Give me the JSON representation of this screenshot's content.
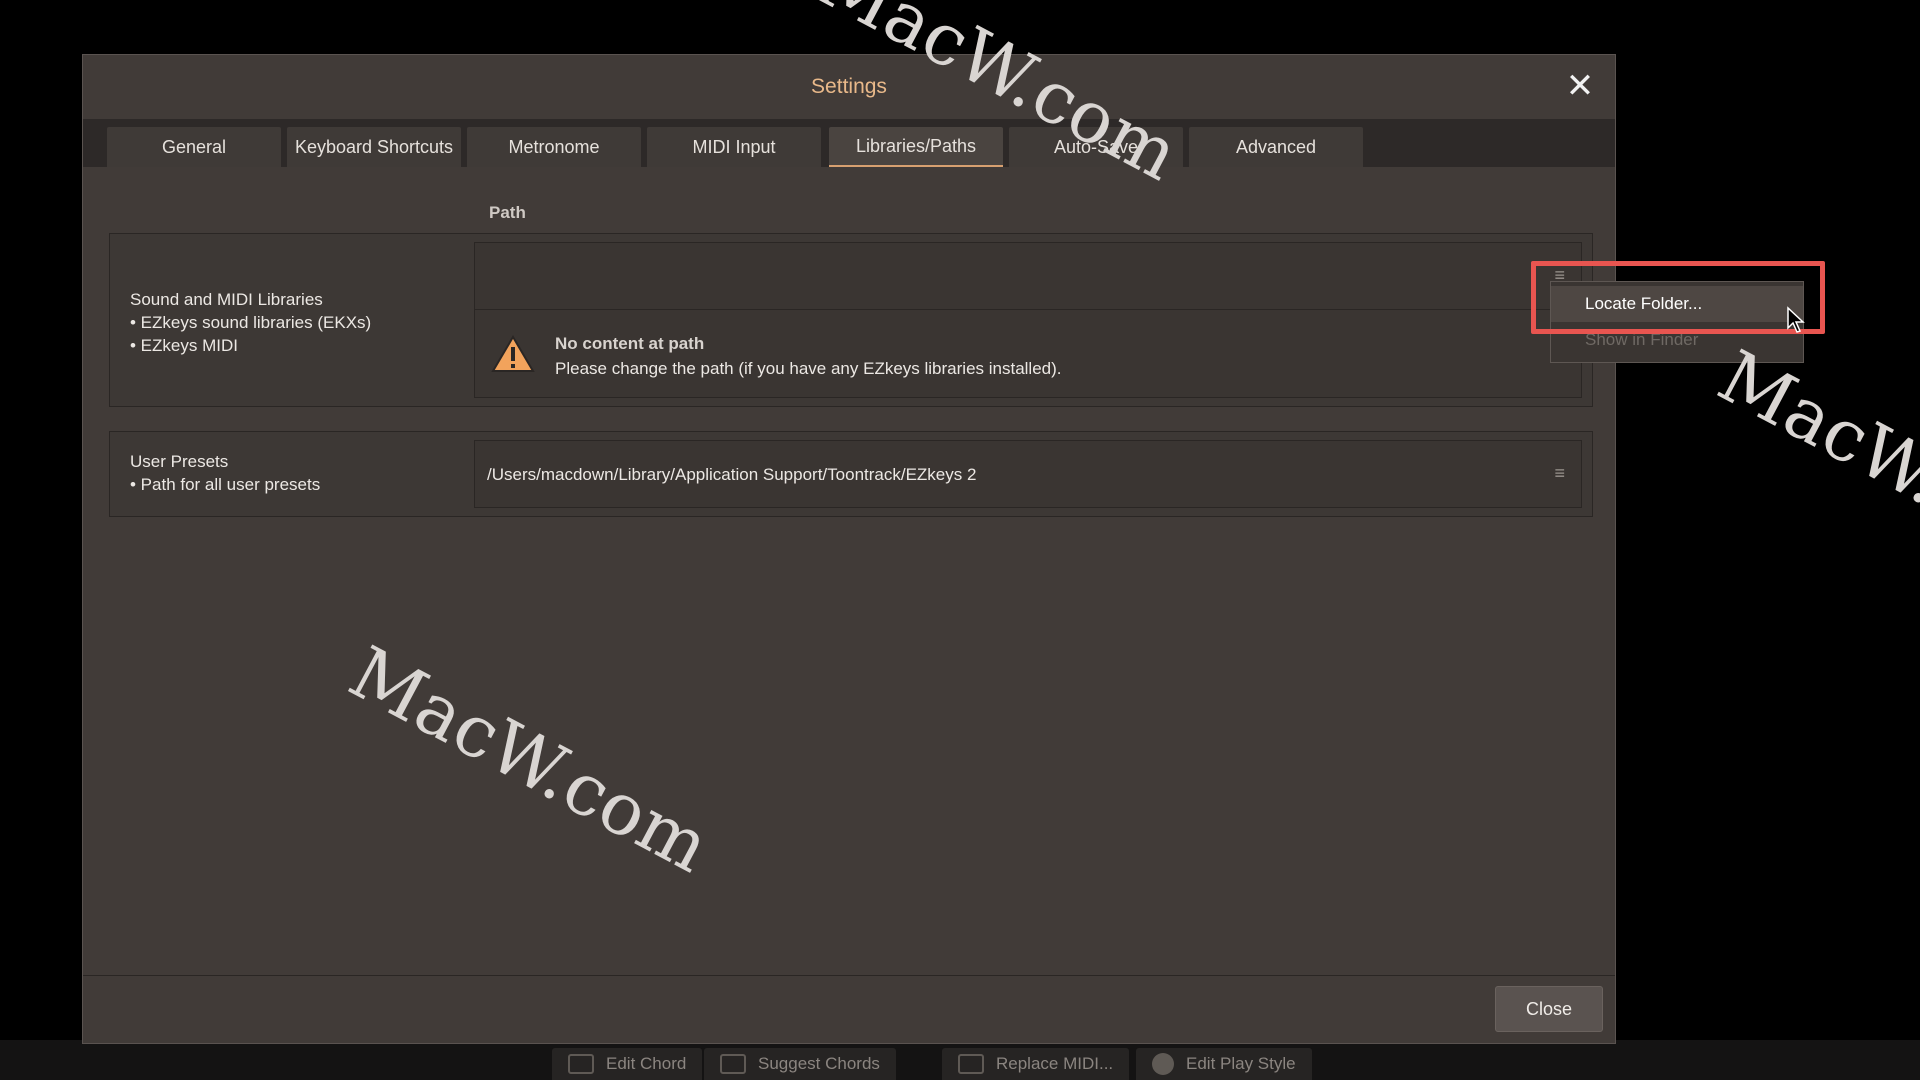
{
  "dialog": {
    "title": "Settings",
    "close_icon": "close-icon",
    "tabs": [
      {
        "label": "General"
      },
      {
        "label": "Keyboard Shortcuts"
      },
      {
        "label": "Metronome"
      },
      {
        "label": "MIDI Input"
      },
      {
        "label": "Libraries/Paths",
        "active": true
      },
      {
        "label": "Auto-Save"
      },
      {
        "label": "Advanced"
      }
    ],
    "column_header": "Path",
    "sections": [
      {
        "title": "Sound and MIDI Libraries",
        "bullets": [
          "• EZkeys sound libraries (EKXs)",
          "• EZkeys MIDI"
        ],
        "path": "",
        "warning": {
          "icon": "warning-icon",
          "title": "No content at path",
          "message": "Please change the path (if you have any EZkeys libraries installed)."
        }
      },
      {
        "title": "User Presets",
        "bullets": [
          "• Path for all user presets"
        ],
        "path": "/Users/macdown/Library/Application Support/Toontrack/EZkeys 2"
      }
    ],
    "menu_icon": "≡",
    "close_button": "Close"
  },
  "context_menu": {
    "items": [
      {
        "label": "Locate Folder...",
        "enabled": true
      },
      {
        "label": "Show in Finder",
        "enabled": false
      }
    ]
  },
  "host_toolbar": {
    "buttons": [
      "Edit Chord",
      "Suggest Chords",
      "Replace MIDI...",
      "Edit Play Style"
    ]
  },
  "watermark": "MacW.com",
  "colors": {
    "accent": "#e9b98a",
    "highlight": "#e85550",
    "dialog_bg": "#413b38"
  }
}
